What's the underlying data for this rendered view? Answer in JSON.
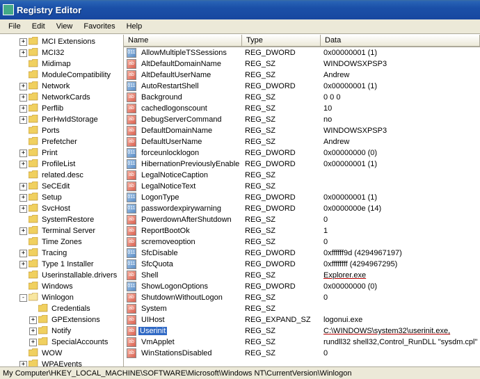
{
  "window": {
    "title": "Registry Editor"
  },
  "menu": {
    "items": [
      "File",
      "Edit",
      "View",
      "Favorites",
      "Help"
    ]
  },
  "tree": [
    {
      "level": 2,
      "exp": "+",
      "name": "MCI Extensions"
    },
    {
      "level": 2,
      "exp": "+",
      "name": "MCI32"
    },
    {
      "level": 2,
      "exp": " ",
      "name": "Midimap"
    },
    {
      "level": 2,
      "exp": " ",
      "name": "ModuleCompatibility"
    },
    {
      "level": 2,
      "exp": "+",
      "name": "Network"
    },
    {
      "level": 2,
      "exp": "+",
      "name": "NetworkCards"
    },
    {
      "level": 2,
      "exp": "+",
      "name": "Perflib"
    },
    {
      "level": 2,
      "exp": "+",
      "name": "PerHwIdStorage"
    },
    {
      "level": 2,
      "exp": " ",
      "name": "Ports"
    },
    {
      "level": 2,
      "exp": " ",
      "name": "Prefetcher"
    },
    {
      "level": 2,
      "exp": "+",
      "name": "Print"
    },
    {
      "level": 2,
      "exp": "+",
      "name": "ProfileList"
    },
    {
      "level": 2,
      "exp": " ",
      "name": "related.desc"
    },
    {
      "level": 2,
      "exp": "+",
      "name": "SeCEdit"
    },
    {
      "level": 2,
      "exp": "+",
      "name": "Setup"
    },
    {
      "level": 2,
      "exp": "+",
      "name": "SvcHost"
    },
    {
      "level": 2,
      "exp": " ",
      "name": "SystemRestore"
    },
    {
      "level": 2,
      "exp": "+",
      "name": "Terminal Server"
    },
    {
      "level": 2,
      "exp": " ",
      "name": "Time Zones"
    },
    {
      "level": 2,
      "exp": "+",
      "name": "Tracing"
    },
    {
      "level": 2,
      "exp": "+",
      "name": "Type 1 Installer"
    },
    {
      "level": 2,
      "exp": " ",
      "name": "Userinstallable.drivers"
    },
    {
      "level": 2,
      "exp": " ",
      "name": "Windows"
    },
    {
      "level": 2,
      "exp": "-",
      "name": "Winlogon",
      "selected": false
    },
    {
      "level": 3,
      "exp": " ",
      "name": "Credentials"
    },
    {
      "level": 3,
      "exp": "+",
      "name": "GPExtensions"
    },
    {
      "level": 3,
      "exp": "+",
      "name": "Notify"
    },
    {
      "level": 3,
      "exp": "+",
      "name": "SpecialAccounts"
    },
    {
      "level": 2,
      "exp": " ",
      "name": "WOW"
    },
    {
      "level": 2,
      "exp": "+",
      "name": "WPAEvents"
    }
  ],
  "list": {
    "columns": [
      "Name",
      "Type",
      "Data"
    ],
    "rows": [
      {
        "icon": "dword",
        "name": "AllowMultipleTSSessions",
        "type": "REG_DWORD",
        "data": "0x00000001 (1)"
      },
      {
        "icon": "sz",
        "name": "AltDefaultDomainName",
        "type": "REG_SZ",
        "data": "WINDOWSXPSP3"
      },
      {
        "icon": "sz",
        "name": "AltDefaultUserName",
        "type": "REG_SZ",
        "data": "Andrew"
      },
      {
        "icon": "dword",
        "name": "AutoRestartShell",
        "type": "REG_DWORD",
        "data": "0x00000001 (1)"
      },
      {
        "icon": "sz",
        "name": "Background",
        "type": "REG_SZ",
        "data": "0 0 0"
      },
      {
        "icon": "sz",
        "name": "cachedlogonscount",
        "type": "REG_SZ",
        "data": "10"
      },
      {
        "icon": "sz",
        "name": "DebugServerCommand",
        "type": "REG_SZ",
        "data": "no"
      },
      {
        "icon": "sz",
        "name": "DefaultDomainName",
        "type": "REG_SZ",
        "data": "WINDOWSXPSP3"
      },
      {
        "icon": "sz",
        "name": "DefaultUserName",
        "type": "REG_SZ",
        "data": "Andrew"
      },
      {
        "icon": "dword",
        "name": "forceunlocklogon",
        "type": "REG_DWORD",
        "data": "0x00000000 (0)"
      },
      {
        "icon": "dword",
        "name": "HibernationPreviouslyEnabled",
        "type": "REG_DWORD",
        "data": "0x00000001 (1)"
      },
      {
        "icon": "sz",
        "name": "LegalNoticeCaption",
        "type": "REG_SZ",
        "data": ""
      },
      {
        "icon": "sz",
        "name": "LegalNoticeText",
        "type": "REG_SZ",
        "data": ""
      },
      {
        "icon": "dword",
        "name": "LogonType",
        "type": "REG_DWORD",
        "data": "0x00000001 (1)"
      },
      {
        "icon": "dword",
        "name": "passwordexpirywarning",
        "type": "REG_DWORD",
        "data": "0x0000000e (14)"
      },
      {
        "icon": "sz",
        "name": "PowerdownAfterShutdown",
        "type": "REG_SZ",
        "data": "0"
      },
      {
        "icon": "sz",
        "name": "ReportBootOk",
        "type": "REG_SZ",
        "data": "1"
      },
      {
        "icon": "sz",
        "name": "scremoveoption",
        "type": "REG_SZ",
        "data": "0"
      },
      {
        "icon": "dword",
        "name": "SfcDisable",
        "type": "REG_DWORD",
        "data": "0xffffff9d (4294967197)"
      },
      {
        "icon": "dword",
        "name": "SfcQuota",
        "type": "REG_DWORD",
        "data": "0xffffffff (4294967295)"
      },
      {
        "icon": "sz",
        "name": "Shell",
        "type": "REG_SZ",
        "data": "Explorer.exe",
        "underlineData": true
      },
      {
        "icon": "dword",
        "name": "ShowLogonOptions",
        "type": "REG_DWORD",
        "data": "0x00000000 (0)"
      },
      {
        "icon": "sz",
        "name": "ShutdownWithoutLogon",
        "type": "REG_SZ",
        "data": "0"
      },
      {
        "icon": "sz",
        "name": "System",
        "type": "REG_SZ",
        "data": ""
      },
      {
        "icon": "sz",
        "name": "UIHost",
        "type": "REG_EXPAND_SZ",
        "data": "logonui.exe"
      },
      {
        "icon": "sz",
        "name": "Userinit",
        "type": "REG_SZ",
        "data": "C:\\WINDOWS\\system32\\userinit.exe,",
        "selected": true,
        "underlineData": true
      },
      {
        "icon": "sz",
        "name": "VmApplet",
        "type": "REG_SZ",
        "data": "rundll32 shell32,Control_RunDLL \"sysdm.cpl\""
      },
      {
        "icon": "sz",
        "name": "WinStationsDisabled",
        "type": "REG_SZ",
        "data": "0"
      }
    ]
  },
  "statusbar": {
    "path": "My Computer\\HKEY_LOCAL_MACHINE\\SOFTWARE\\Microsoft\\Windows NT\\CurrentVersion\\Winlogon"
  }
}
